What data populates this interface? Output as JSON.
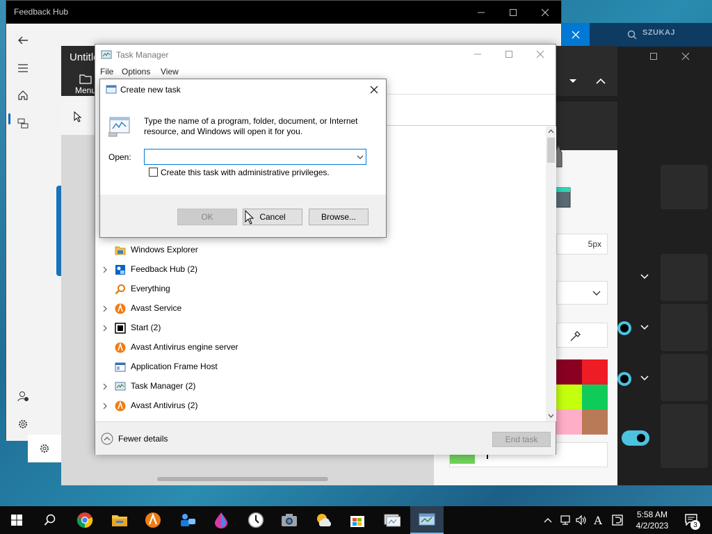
{
  "feedback_hub": {
    "title": "Feedback Hub"
  },
  "paint": {
    "title": "Untitle",
    "menu_label": "Menu",
    "brush_size": "5px"
  },
  "dark_panel": {
    "search_label": "SZUKAJ"
  },
  "task_manager": {
    "title": "Task Manager",
    "menu": [
      "File",
      "Options",
      "View"
    ],
    "processes": [
      {
        "name": "Windows Explorer",
        "expandable": false
      },
      {
        "name": "Feedback Hub (2)",
        "expandable": true
      },
      {
        "name": "Everything",
        "expandable": false
      },
      {
        "name": "Avast Service",
        "expandable": true
      },
      {
        "name": "Start (2)",
        "expandable": true
      },
      {
        "name": "Avast Antivirus engine server",
        "expandable": false
      },
      {
        "name": "Application Frame Host",
        "expandable": false
      },
      {
        "name": "Task Manager (2)",
        "expandable": true
      },
      {
        "name": "Avast Antivirus (2)",
        "expandable": true
      }
    ],
    "fewer_details": "Fewer details",
    "end_task": "End task"
  },
  "dialog": {
    "title": "Create new task",
    "description": "Type the name of a program, folder, document, or Internet resource, and Windows will open it for you.",
    "open_label": "Open:",
    "open_value": "",
    "admin_checkbox_label": "Create this task with administrative privileges.",
    "admin_checked": false,
    "ok_label": "OK",
    "cancel_label": "Cancel",
    "browse_label": "Browse..."
  },
  "taskbar": {
    "time": "5:58 AM",
    "date": "4/2/2023",
    "notification_count": "3",
    "lang": "A"
  },
  "colors": {
    "accent": "#0078d7",
    "taskbar_bg": "#0b0b0b",
    "avast_orange": "#f07c14"
  }
}
